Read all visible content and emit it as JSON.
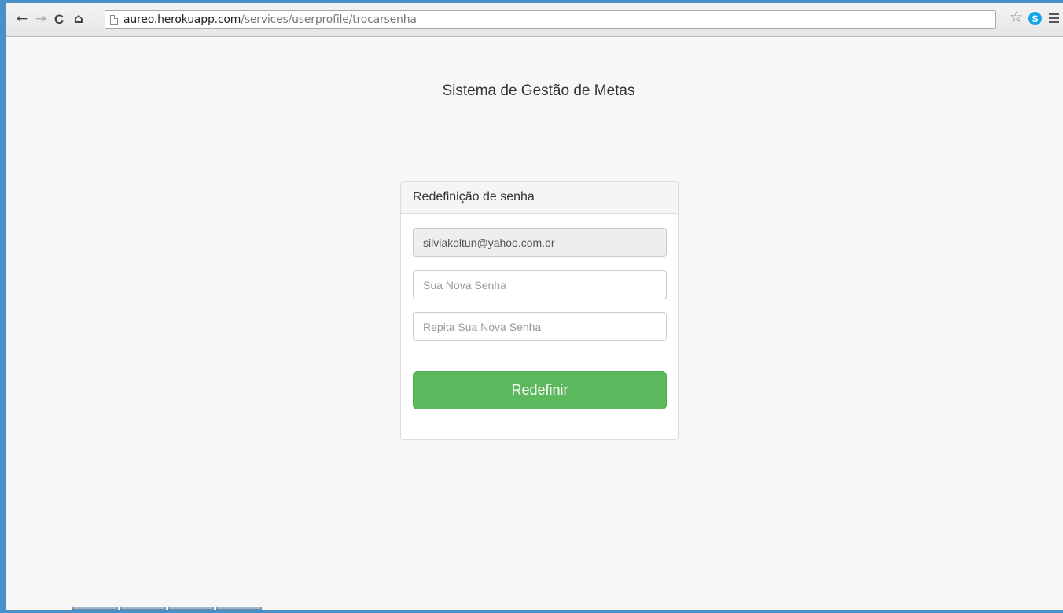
{
  "browser": {
    "url_host": "aureo.herokuapp.com",
    "url_path": "/services/userprofile/trocarsenha",
    "back_icon": "←",
    "forward_icon": "→",
    "reload_icon": "C",
    "home_icon": "⌂",
    "bookmark_star_icon": "☆",
    "skype_extension_label": "S"
  },
  "page": {
    "app_title": "Sistema de Gestão de Metas",
    "panel_title": "Redefinição de senha",
    "email_value": "silviakoltun@yahoo.com.br",
    "new_password_placeholder": "Sua Nova Senha",
    "repeat_password_placeholder": "Repita Sua Nova Senha",
    "submit_label": "Redefinir"
  },
  "colors": {
    "submit_button": "#5cb85c",
    "page_background": "#f7f7f7",
    "window_frame": "#4a90c8"
  }
}
